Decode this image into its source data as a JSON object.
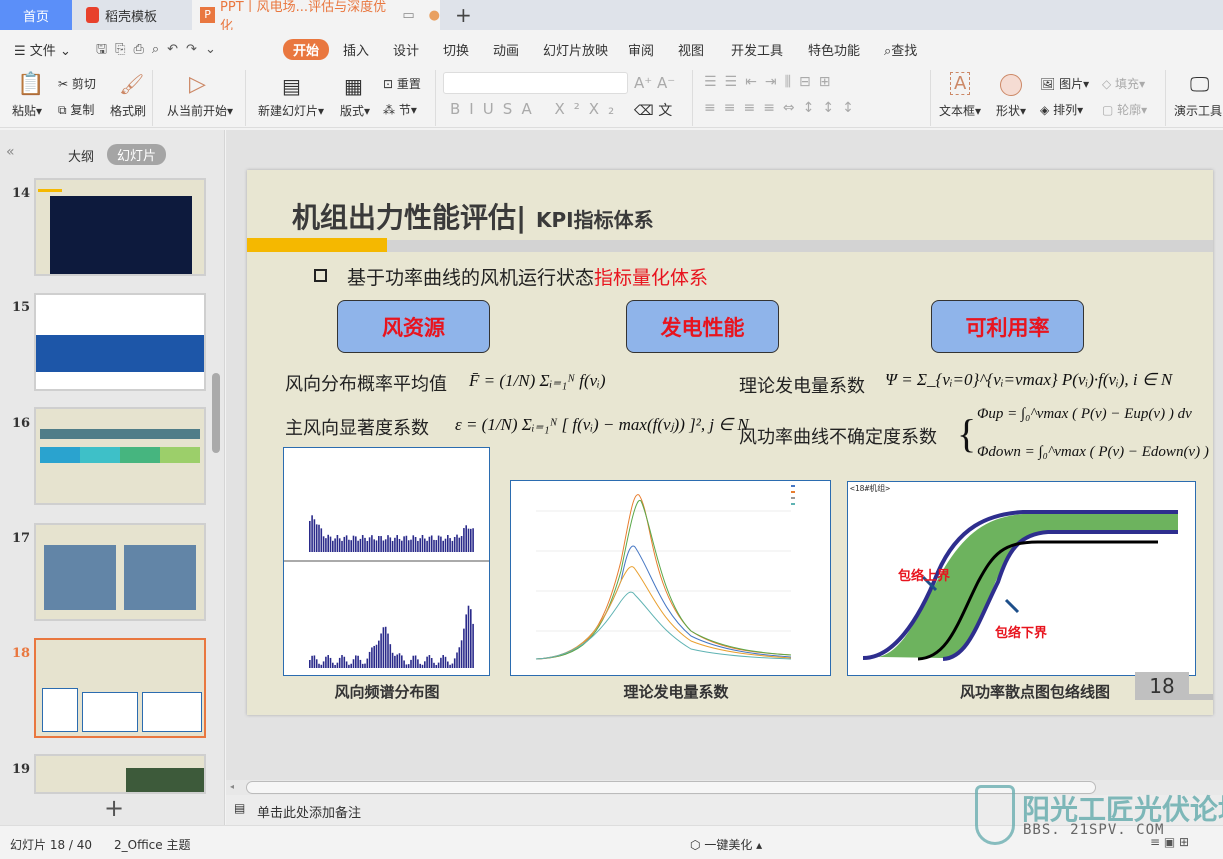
{
  "tabs": [
    {
      "label": "首页"
    },
    {
      "label": "稻壳模板"
    },
    {
      "label": "PPT丨风电场...评估与深度优化"
    }
  ],
  "menu": {
    "file": "文件",
    "items": [
      "开始",
      "插入",
      "设计",
      "切换",
      "动画",
      "幻灯片放映",
      "审阅",
      "视图",
      "开发工具",
      "特色功能"
    ],
    "search": "查找"
  },
  "ribbon": {
    "paste": "粘贴",
    "cut": "剪切",
    "copy": "复制",
    "format_painter": "格式刷",
    "play_from_current": "从当前开始",
    "new_slide": "新建幻灯片",
    "layout": "版式",
    "reset": "重置",
    "section": "节",
    "textbox": "文本框",
    "shape": "形状",
    "picture": "图片",
    "fill": "填充",
    "arrange": "排列",
    "outline": "轮廓",
    "present_tools": "演示工具"
  },
  "panel": {
    "outline_tab": "大纲",
    "slides_tab": "幻灯片",
    "slides": [
      {
        "num": "14"
      },
      {
        "num": "15"
      },
      {
        "num": "16"
      },
      {
        "num": "17"
      },
      {
        "num": "18"
      },
      {
        "num": "19"
      }
    ]
  },
  "slide": {
    "title": "机组出力性能评估|",
    "subtitle": "KPI指标体系",
    "bullet_prefix": "基于功率曲线的风机运行状态",
    "bullet_highlight": "指标量化体系",
    "boxes": [
      "风资源",
      "发电性能",
      "可利用率"
    ],
    "metrics": [
      {
        "label": "风向分布概率平均值",
        "formula": "F̄ = (1/N) Σᵢ₌₁ᴺ f(vᵢ)"
      },
      {
        "label": "主风向显著度系数",
        "formula": "ε = (1/N) Σᵢ₌₁ᴺ [ f(vᵢ) − max(f(vⱼ)) ]², j ∈ N"
      },
      {
        "label": "理论发电量系数",
        "formula": "Ψ = Σ_{vᵢ=0}^{vᵢ=vmax} P(vᵢ)·f(vᵢ), i ∈ N"
      },
      {
        "label": "风功率曲线不确定度系数",
        "formula_up": "Φup = ∫₀^vmax ( P(v) − Eup(v) ) dv",
        "formula_down": "Φdown = ∫₀^vmax ( P(v) − Edown(v) ) dv"
      }
    ],
    "captions": [
      "风向频谱分布图",
      "理论发电量系数",
      "风功率散点图包络线图"
    ],
    "scatter_title": "<18#机组>",
    "upper_label": "包络上界",
    "lower_label": "包络下界",
    "page_number": "18"
  },
  "notes_placeholder": "单击此处添加备注",
  "status": {
    "slide_counter": "幻灯片 18 / 40",
    "theme": "2_Office 主题",
    "beautify": "一键美化"
  },
  "watermark": {
    "name": "阳光工匠光伏论坛",
    "url": "BBS. 21SPV. COM"
  },
  "colors": {
    "accent": "#e9773f",
    "home_tab": "#5b8ff9",
    "box": "#8fb4ea",
    "highlight": "#e8141e",
    "bar": "#f5b800"
  }
}
